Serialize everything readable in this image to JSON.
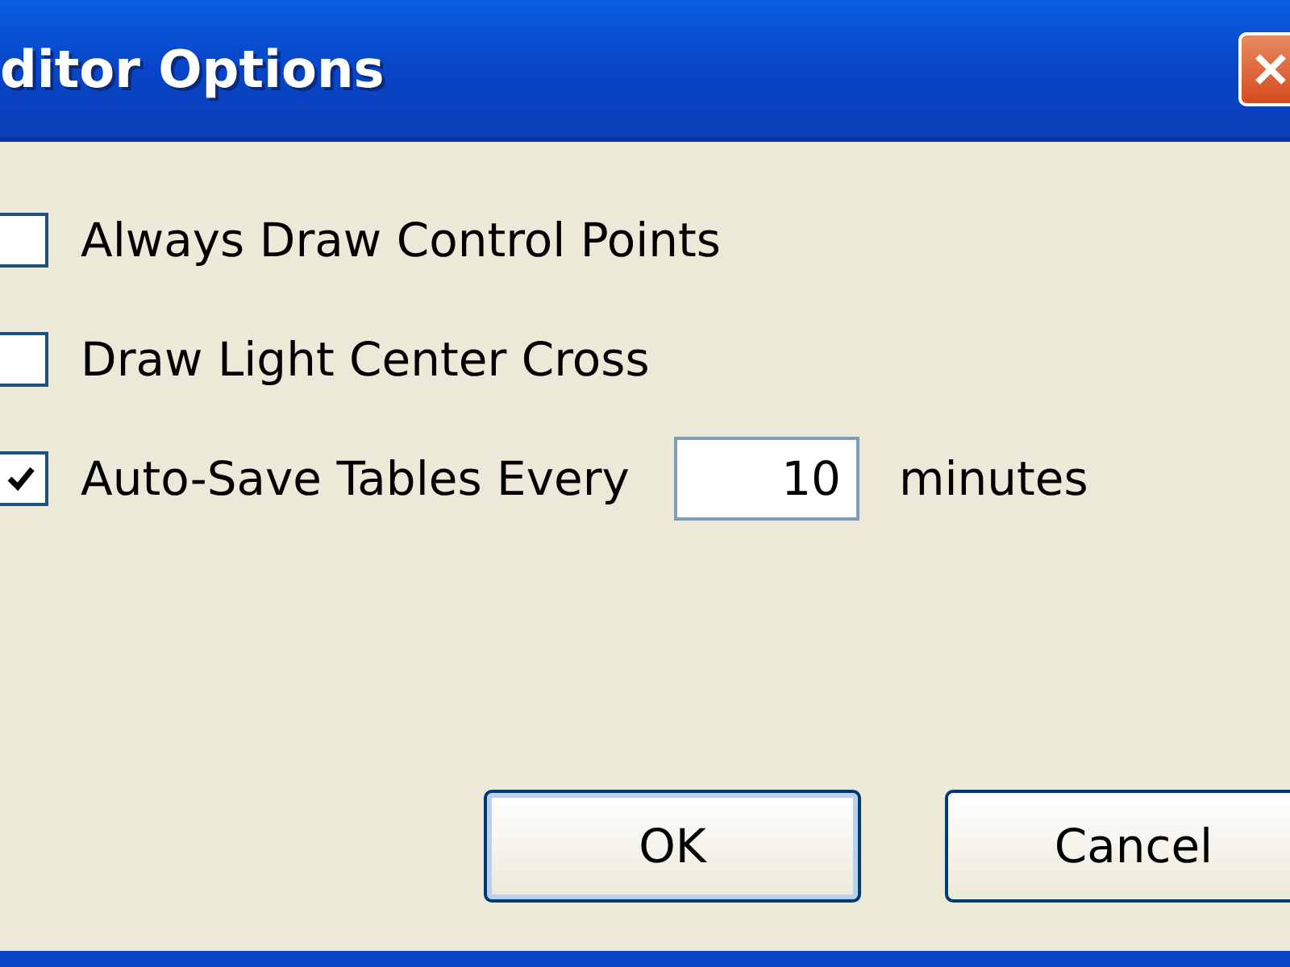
{
  "window": {
    "title": "ditor Options"
  },
  "options": [
    {
      "kind": "checkbox",
      "label": "Always Draw Control Points",
      "checked": false
    },
    {
      "kind": "checkbox",
      "label": "Draw Light Center Cross",
      "checked": false
    },
    {
      "kind": "interval",
      "label": "Auto-Save Tables Every",
      "checked": true,
      "value": "10",
      "unit": "minutes"
    }
  ],
  "buttons": [
    {
      "label": "OK",
      "default": true
    },
    {
      "label": "Cancel",
      "default": false
    }
  ]
}
